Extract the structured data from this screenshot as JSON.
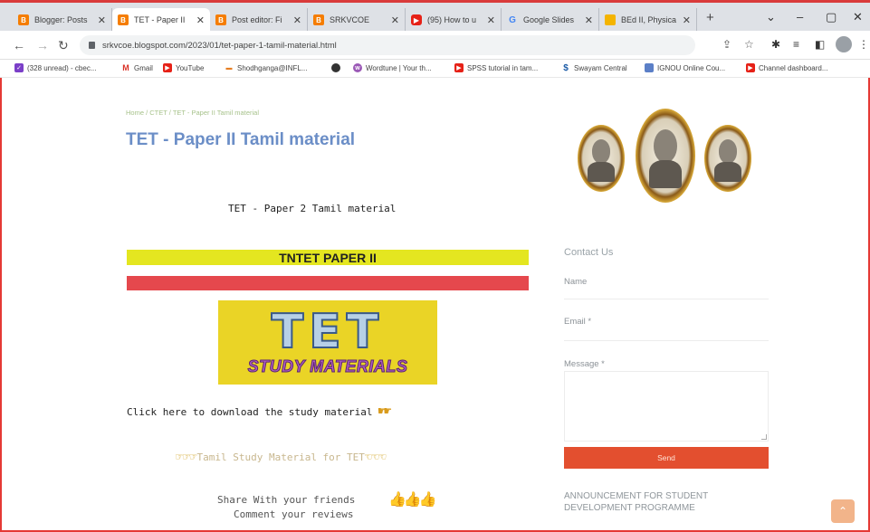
{
  "tabs": [
    {
      "label": "Blogger: Posts",
      "icon": "blogger-icon"
    },
    {
      "label": "TET - Paper II",
      "icon": "blogger-icon",
      "active": true
    },
    {
      "label": "Post editor: Fi",
      "icon": "blogger-icon"
    },
    {
      "label": "SRKVCOE",
      "icon": "blogger-icon"
    },
    {
      "label": "(95) How to u",
      "icon": "youtube-icon"
    },
    {
      "label": "Google Slides",
      "icon": "google-icon"
    },
    {
      "label": "BEd II, Physica",
      "icon": "slides-icon"
    }
  ],
  "address": {
    "url": "srkvcoe.blogspot.com/2023/01/tet-paper-1-tamil-material.html"
  },
  "bookmarks": [
    {
      "label": "(328 unread) - cbec..."
    },
    {
      "label": "Gmail"
    },
    {
      "label": "YouTube"
    },
    {
      "label": "Shodhganga@INFL..."
    },
    {
      "label": ""
    },
    {
      "label": "Wordtune | Your th..."
    },
    {
      "label": "SPSS tutorial in tam..."
    },
    {
      "label": "Swayam Central"
    },
    {
      "label": "IGNOU Online Cou..."
    },
    {
      "label": "Channel dashboard..."
    }
  ],
  "post": {
    "breadcrumb": "Home / CTET / TET - Paper II Tamil material",
    "title": "TET - Paper II Tamil material",
    "subtitle": "TET - Paper 2 Tamil material",
    "banner_text": "TNTET PAPER II",
    "tet_image_big": "TET",
    "tet_image_small": "STUDY MATERIALS",
    "download_text": "Click here to download the study material",
    "study_link": "Tamil Study Material for TET",
    "share_line1": "Share With your friends",
    "share_line2": "Comment your reviews"
  },
  "sidebar": {
    "contact_title": "Contact Us",
    "name_label": "Name",
    "email_label": "Email *",
    "message_label": "Message *",
    "send_label": "Send",
    "announcement": "ANNOUNCEMENT FOR STUDENT DEVELOPMENT PROGRAMME"
  },
  "colors": {
    "title": "#6b8ec7",
    "banner_yellow": "#e4e620",
    "banner_red": "#e5484d",
    "send_button": "#e34f2f"
  }
}
